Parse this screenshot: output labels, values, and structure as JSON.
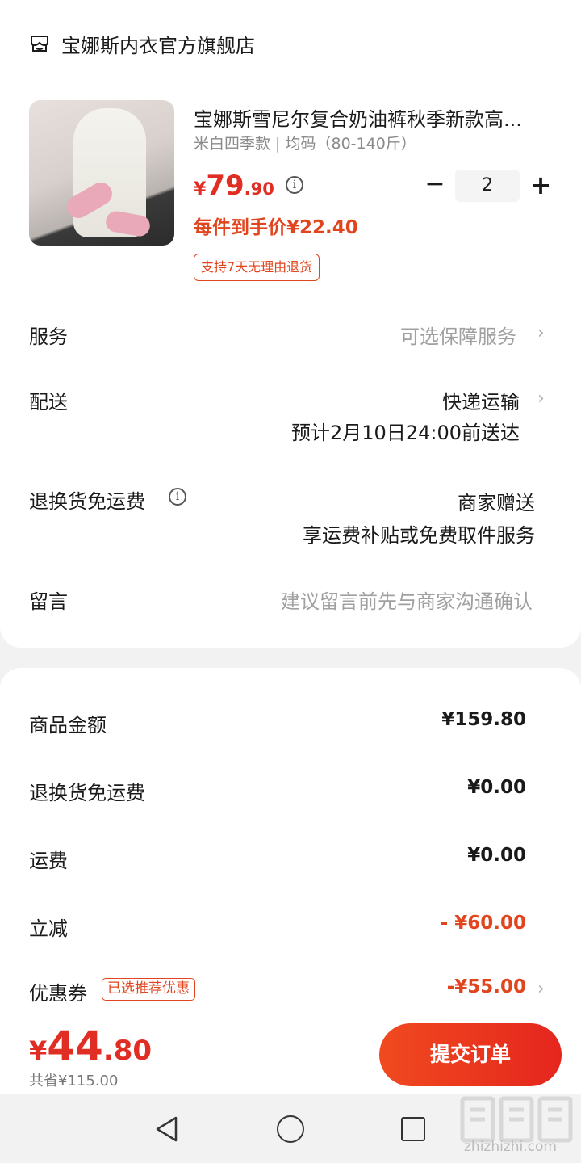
{
  "shop": {
    "name": "宝娜斯内衣官方旗舰店",
    "icon": "shop-icon"
  },
  "product": {
    "title": "宝娜斯雪尼尔复合奶油裤秋季新款高...",
    "spec": "米白四季款 | 均码（80-140斤）",
    "price_currency": "¥",
    "price_int": "79",
    "price_dec": ".90",
    "unit_price": "每件到手价¥22.40",
    "return_badge": "支持7天无理由退货",
    "quantity": "2",
    "minus_label": "−",
    "plus_label": "+"
  },
  "rows": {
    "service": {
      "label": "服务",
      "value": "可选保障服务"
    },
    "delivery": {
      "label": "配送",
      "value": "快递运输",
      "eta": "预计2月10日24:00前送达"
    },
    "return_shipping": {
      "label": "退换货免运费",
      "value": "商家赠送",
      "detail": "享运费补贴或免费取件服务"
    },
    "message": {
      "label": "留言",
      "placeholder": "建议留言前先与商家沟通确认"
    }
  },
  "summary": {
    "goods_amount": {
      "label": "商品金额",
      "value": "¥159.80"
    },
    "return_fee": {
      "label": "退换货免运费",
      "value": "¥0.00"
    },
    "shipping": {
      "label": "运费",
      "value": "¥0.00"
    },
    "discount": {
      "label": "立减",
      "value": "- ¥60.00"
    },
    "coupon": {
      "label": "优惠券",
      "badge": "已选推荐优惠",
      "value": "-¥55.00"
    }
  },
  "footer": {
    "total_currency": "¥",
    "total_int": "44",
    "total_dec": ".80",
    "saved": "共省¥115.00",
    "submit_label": "提交订单"
  },
  "watermark": {
    "text": "zhizhizhi.com"
  },
  "colors": {
    "accent": "#e02e24",
    "accent_orange": "#e0451e",
    "background": "#f2f2f2"
  }
}
